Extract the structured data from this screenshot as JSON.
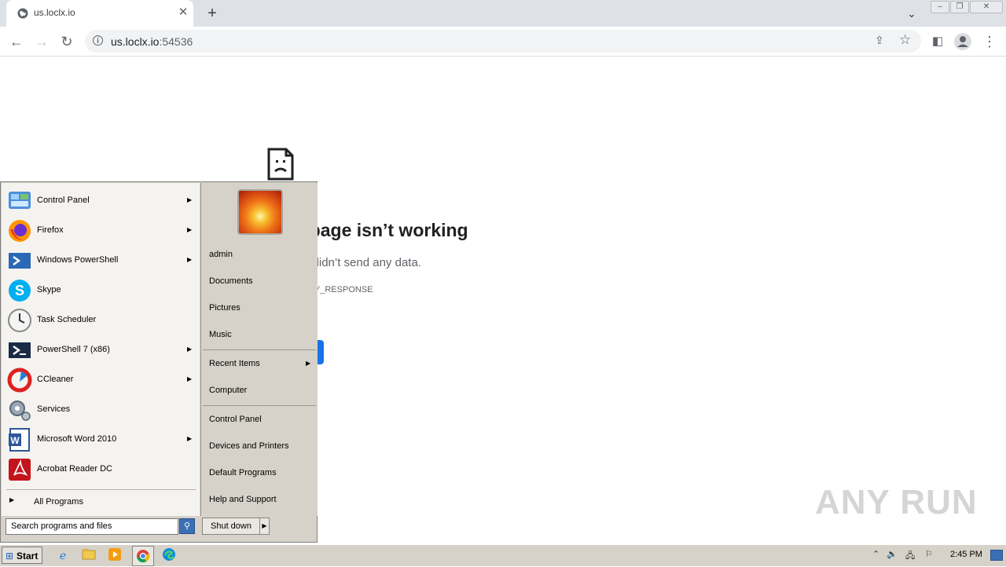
{
  "browser": {
    "tab_title": "us.loclx.io",
    "url_host": "us.loclx.io",
    "url_port": ":54536"
  },
  "error_page": {
    "title": "age isn’t working",
    "description": "didn’t send any data.",
    "code": "_RESPONSE"
  },
  "start_menu": {
    "programs": [
      {
        "label": "Control Panel",
        "icon": "control-panel-icon",
        "has_arrow": true
      },
      {
        "label": "Firefox",
        "icon": "firefox-icon",
        "has_arrow": true
      },
      {
        "label": "Windows PowerShell",
        "icon": "powershell-icon",
        "has_arrow": true
      },
      {
        "label": "Skype",
        "icon": "skype-icon",
        "has_arrow": false
      },
      {
        "label": "Task Scheduler",
        "icon": "task-scheduler-icon",
        "has_arrow": false
      },
      {
        "label": "PowerShell 7 (x86)",
        "icon": "powershell7-icon",
        "has_arrow": true
      },
      {
        "label": "CCleaner",
        "icon": "ccleaner-icon",
        "has_arrow": true
      },
      {
        "label": "Services",
        "icon": "services-icon",
        "has_arrow": false
      },
      {
        "label": "Microsoft Word 2010",
        "icon": "word-icon",
        "has_arrow": true
      },
      {
        "label": "Acrobat Reader DC",
        "icon": "acrobat-icon",
        "has_arrow": false
      }
    ],
    "all_programs": "All Programs",
    "right": {
      "user": "admin",
      "documents": "Documents",
      "pictures": "Pictures",
      "music": "Music",
      "recent_items": "Recent Items",
      "computer": "Computer",
      "control_panel": "Control Panel",
      "devices_printers": "Devices and Printers",
      "default_programs": "Default Programs",
      "help_support": "Help and Support"
    },
    "search_placeholder": "Search programs and files",
    "shutdown": "Shut down"
  },
  "taskbar": {
    "start": "Start",
    "clock": "2:45 PM",
    "pinned": [
      "ie-icon",
      "explorer-icon",
      "media-player-icon",
      "chrome-icon",
      "edge-icon"
    ]
  },
  "watermark": "ANY RUN"
}
